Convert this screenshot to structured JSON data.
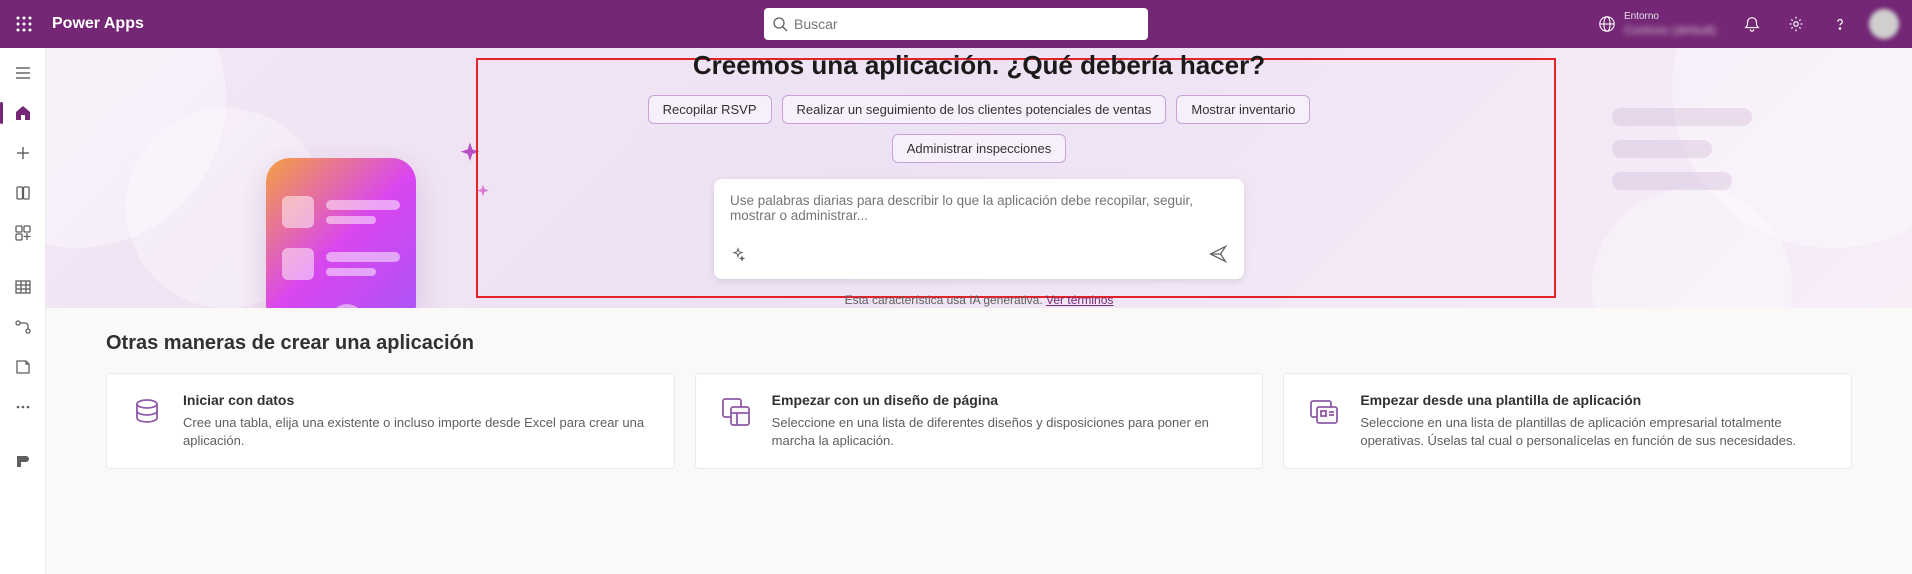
{
  "header": {
    "app_name": "Power Apps",
    "search_placeholder": "Buscar",
    "env_label": "Entorno",
    "env_name": "Contoso (default)"
  },
  "hero": {
    "title": "Creemos una aplicación. ¿Qué debería hacer?",
    "chips": [
      "Recopilar RSVP",
      "Realizar un seguimiento de los clientes potenciales de ventas",
      "Mostrar inventario",
      "Administrar inspecciones"
    ],
    "prompt_placeholder": "Use palabras diarias para describir lo que la aplicación debe recopilar, seguir, mostrar o administrar...",
    "gen_note_prefix": "Esta característica usa IA generativa. ",
    "gen_note_link": "Ver términos"
  },
  "section": {
    "title": "Otras maneras de crear una aplicación",
    "cards": [
      {
        "title": "Iniciar con datos",
        "desc": "Cree una tabla, elija una existente o incluso importe desde Excel para crear una aplicación."
      },
      {
        "title": "Empezar con un diseño de página",
        "desc": "Seleccione en una lista de diferentes diseños y disposiciones para poner en marcha la aplicación."
      },
      {
        "title": "Empezar desde una plantilla de aplicación",
        "desc": "Seleccione en una lista de plantillas de aplicación empresarial totalmente operativas. Úselas tal cual o personalícelas en función de sus necesidades."
      }
    ]
  }
}
